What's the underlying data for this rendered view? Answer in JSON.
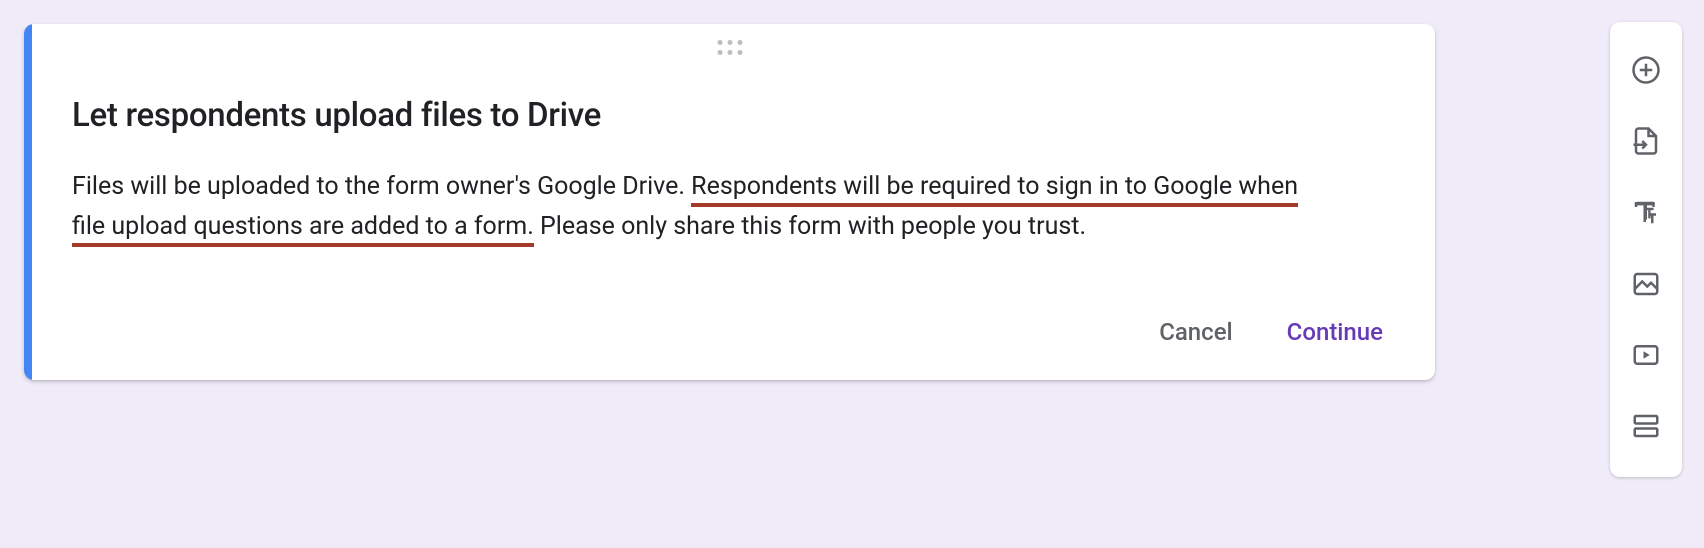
{
  "dialog": {
    "title": "Let respondents upload files to Drive",
    "body_pre": "Files will be uploaded to the form owner's Google Drive. ",
    "body_underlined1": "Respondents will be required to sign in to Google when",
    "body_mid": " ",
    "body_underlined2": "file upload questions are added to a form.",
    "body_post": " Please only share this form with people you trust.",
    "cancel_label": "Cancel",
    "continue_label": "Continue"
  },
  "sidebar": {
    "add_question": "Add question",
    "import_questions": "Import questions",
    "add_title": "Add title and description",
    "add_image": "Add image",
    "add_video": "Add video",
    "add_section": "Add section"
  }
}
